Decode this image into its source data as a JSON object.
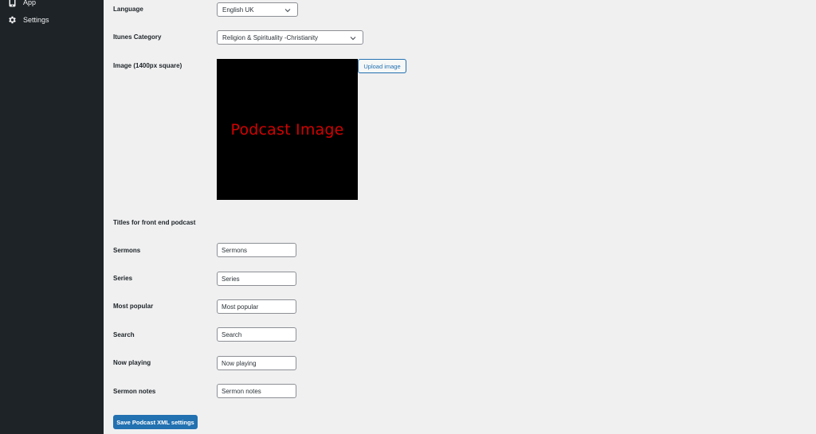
{
  "sidebar": {
    "items": [
      {
        "label": "App",
        "icon": "phone-icon"
      },
      {
        "label": "Settings",
        "icon": "gear-icon"
      }
    ]
  },
  "form": {
    "language": {
      "label": "Language",
      "value": "English UK"
    },
    "itunes_category": {
      "label": "Itunes Category",
      "value": "Religion & Spirituality -Christianity"
    },
    "image": {
      "label": "Image (1400px square)",
      "preview_text": "Podcast Image",
      "upload_label": "Upload image"
    },
    "titles_heading": "Titles for front end podcast",
    "fields": [
      {
        "label": "Sermons",
        "value": "Sermons"
      },
      {
        "label": "Series",
        "value": "Series"
      },
      {
        "label": "Most popular",
        "value": "Most popular"
      },
      {
        "label": "Search",
        "value": "Search"
      },
      {
        "label": "Now playing",
        "value": "Now playing"
      },
      {
        "label": "Sermon notes",
        "value": "Sermon notes"
      }
    ],
    "save_label": "Save Podcast XML settings"
  },
  "colors": {
    "sidebar_bg": "#1d2327",
    "accent": "#2271b1",
    "image_text": "#d40000"
  }
}
